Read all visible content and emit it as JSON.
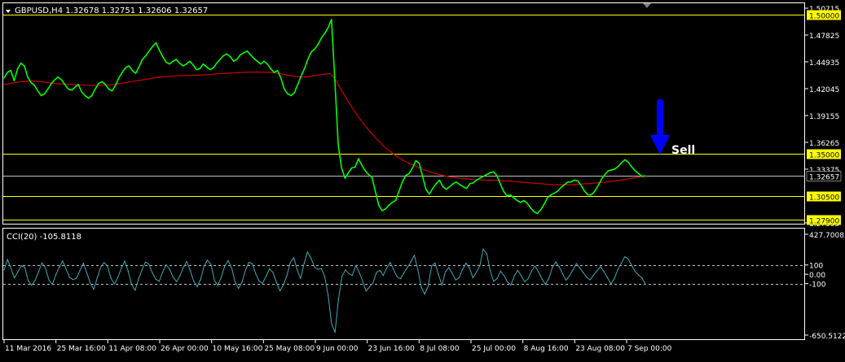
{
  "chart_data": [
    {
      "type": "candlestick-line",
      "title": "GBPUSD,H4  1.32678 1.32751 1.32606 1.32657",
      "symbol": "GBPUSD",
      "timeframe": "H4",
      "ohlc": {
        "open": 1.32678,
        "high": 1.32751,
        "low": 1.32606,
        "close": 1.32657
      },
      "x_tick_labels": [
        "11 Mar 2016",
        "25 Mar 16:00",
        "11 Apr 08:00",
        "26 Apr 00:00",
        "10 May 16:00",
        "25 May 08:00",
        "9 Jun 00:00",
        "23 Jun 16:00",
        "8 Jul 08:00",
        "25 Jul 00:00",
        "8 Aug 16:00",
        "23 Aug 08:00",
        "7 Sep 00:00"
      ],
      "y_tick_labels": [
        "1.50715",
        "1.47825",
        "1.44935",
        "1.42045",
        "1.39155",
        "1.36265",
        "1.33375",
        "1.27595"
      ],
      "ylim": [
        1.2759,
        1.5072
      ],
      "horizontal_levels": [
        {
          "value": 1.5,
          "label": "1.50000",
          "color": "#ffff00"
        },
        {
          "value": 1.35,
          "label": "1.35000",
          "color": "#ffff00"
        },
        {
          "value": 1.305,
          "label": "1.30500",
          "color": "#ffff00"
        },
        {
          "value": 1.279,
          "label": "1.27900",
          "color": "#ffff00"
        }
      ],
      "current_price": {
        "value": 1.32657,
        "label": "1.32657",
        "color": "#c0c0c0"
      },
      "series": [
        {
          "style": "price",
          "color": "#00ff00",
          "values": [
            1.432,
            1.438,
            1.44,
            1.429,
            1.442,
            1.448,
            1.445,
            1.433,
            1.427,
            1.424,
            1.418,
            1.413,
            1.415,
            1.42,
            1.426,
            1.43,
            1.433,
            1.43,
            1.425,
            1.42,
            1.419,
            1.422,
            1.425,
            1.417,
            1.413,
            1.41,
            1.413,
            1.42,
            1.426,
            1.428,
            1.425,
            1.42,
            1.418,
            1.424,
            1.432,
            1.438,
            1.443,
            1.445,
            1.44,
            1.437,
            1.444,
            1.452,
            1.456,
            1.461,
            1.466,
            1.47,
            1.462,
            1.455,
            1.449,
            1.447,
            1.45,
            1.452,
            1.448,
            1.445,
            1.447,
            1.45,
            1.446,
            1.441,
            1.442,
            1.447,
            1.444,
            1.441,
            1.443,
            1.448,
            1.452,
            1.456,
            1.458,
            1.455,
            1.45,
            1.452,
            1.457,
            1.459,
            1.461,
            1.457,
            1.453,
            1.45,
            1.447,
            1.45,
            1.447,
            1.442,
            1.438,
            1.44,
            1.432,
            1.42,
            1.415,
            1.413,
            1.416,
            1.425,
            1.434,
            1.442,
            1.452,
            1.46,
            1.463,
            1.468,
            1.475,
            1.48,
            1.486,
            1.495,
            1.43,
            1.36,
            1.335,
            1.324,
            1.33,
            1.335,
            1.336,
            1.345,
            1.338,
            1.332,
            1.328,
            1.325,
            1.31,
            1.295,
            1.289,
            1.291,
            1.295,
            1.298,
            1.3,
            1.31,
            1.32,
            1.327,
            1.329,
            1.335,
            1.343,
            1.34,
            1.326,
            1.312,
            1.307,
            1.313,
            1.318,
            1.322,
            1.315,
            1.312,
            1.315,
            1.318,
            1.32,
            1.317,
            1.315,
            1.313,
            1.318,
            1.319,
            1.322,
            1.324,
            1.326,
            1.328,
            1.33,
            1.331,
            1.327,
            1.318,
            1.31,
            1.305,
            1.306,
            1.303,
            1.3,
            1.298,
            1.3,
            1.297,
            1.292,
            1.288,
            1.286,
            1.29,
            1.296,
            1.303,
            1.306,
            1.308,
            1.31,
            1.314,
            1.317,
            1.32,
            1.32,
            1.322,
            1.321,
            1.316,
            1.31,
            1.306,
            1.306,
            1.31,
            1.316,
            1.323,
            1.328,
            1.332,
            1.333,
            1.334,
            1.337,
            1.341,
            1.344,
            1.341,
            1.336,
            1.332,
            1.329,
            1.326,
            1.3265
          ]
        },
        {
          "style": "moving-average",
          "color": "#cc0000",
          "values": [
            1.4248,
            1.4255,
            1.4262,
            1.4268,
            1.4275,
            1.428,
            1.4284,
            1.4287,
            1.4288,
            1.4286,
            1.4283,
            1.428,
            1.4275,
            1.427,
            1.4264,
            1.426,
            1.4257,
            1.4255,
            1.4254,
            1.4253,
            1.4251,
            1.425,
            1.4247,
            1.4245,
            1.4243,
            1.4242,
            1.424,
            1.424,
            1.424,
            1.4241,
            1.4242,
            1.4244,
            1.4247,
            1.4252,
            1.4258,
            1.4264,
            1.427,
            1.4276,
            1.4281,
            1.4286,
            1.4292,
            1.4298,
            1.4304,
            1.431,
            1.4316,
            1.4322,
            1.4327,
            1.4331,
            1.4334,
            1.4337,
            1.4339,
            1.4342,
            1.4344,
            1.4345,
            1.4347,
            1.4348,
            1.4349,
            1.4349,
            1.435,
            1.4352,
            1.4354,
            1.4356,
            1.4359,
            1.4362,
            1.4365,
            1.4368,
            1.437,
            1.4372,
            1.4374,
            1.4376,
            1.4378,
            1.438,
            1.4381,
            1.4382,
            1.4383,
            1.4383,
            1.4383,
            1.4382,
            1.4381,
            1.438,
            1.4377,
            1.4373,
            1.4368,
            1.4361,
            1.4354,
            1.4347,
            1.4341,
            1.4336,
            1.4332,
            1.433,
            1.4332,
            1.4336,
            1.4341,
            1.4346,
            1.4352,
            1.4358,
            1.4363,
            1.4368,
            1.4337,
            1.4279,
            1.4217,
            1.4156,
            1.4096,
            1.4038,
            1.3982,
            1.3929,
            1.3878,
            1.3829,
            1.3784,
            1.3742,
            1.3701,
            1.3661,
            1.3624,
            1.3589,
            1.3557,
            1.3527,
            1.35,
            1.3474,
            1.3452,
            1.3431,
            1.3412,
            1.3395,
            1.3379,
            1.3363,
            1.3348,
            1.3333,
            1.332,
            1.3307,
            1.3296,
            1.3286,
            1.3276,
            1.3268,
            1.326,
            1.3254,
            1.3249,
            1.3244,
            1.3239,
            1.3236,
            1.3232,
            1.3229,
            1.3226,
            1.3224,
            1.3222,
            1.322,
            1.3219,
            1.3218,
            1.3217,
            1.3216,
            1.3214,
            1.3212,
            1.321,
            1.3207,
            1.3204,
            1.3201,
            1.3198,
            1.3195,
            1.3192,
            1.3189,
            1.3186,
            1.3183,
            1.318,
            1.3177,
            1.3175,
            1.3173,
            1.3171,
            1.317,
            1.317,
            1.317,
            1.3171,
            1.3172,
            1.3174,
            1.3176,
            1.3178,
            1.318,
            1.3182,
            1.3185,
            1.3188,
            1.3191,
            1.3195,
            1.3199,
            1.3203,
            1.3207,
            1.3212,
            1.3217,
            1.3222,
            1.3228,
            1.3234,
            1.324,
            1.3246,
            1.3252,
            1.3258,
            1.3264
          ]
        }
      ],
      "annotation": {
        "text": "Sell",
        "arrow_direction": "down",
        "arrow_color": "#0000ff",
        "text_color": "#ffffff"
      }
    },
    {
      "type": "line",
      "title": "CCI(20) -105.8118",
      "indicator": "CCI",
      "period": 20,
      "current_value": -105.8118,
      "y_tick_labels": [
        "427.7008",
        "100",
        "0.00",
        "-100",
        "-650.5122"
      ],
      "ylim": [
        -650.5122,
        427.7008
      ],
      "reference_levels": [
        100,
        0,
        -100
      ],
      "series": [
        {
          "color": "#3fa9b6",
          "values": [
            47,
            159,
            61,
            -39,
            24,
            91,
            75,
            -69,
            -118,
            -65,
            25,
            123,
            67,
            -60,
            -108,
            -7,
            75,
            143,
            51,
            -34,
            -57,
            -42,
            41,
            120,
            16,
            -92,
            -161,
            -42,
            72,
            126,
            87,
            -43,
            -104,
            -33,
            64,
            142,
            33,
            -111,
            -171,
            -51,
            48,
            131,
            108,
            18,
            -53,
            -75,
            23,
            102,
            54,
            -28,
            -78,
            -18,
            75,
            136,
            38,
            -72,
            -133,
            -54,
            86,
            151,
            107,
            -63,
            -118,
            -28,
            87,
            148,
            69,
            -82,
            -150,
            -86,
            41,
            129,
            114,
            4,
            -76,
            -95,
            -19,
            58,
            21,
            -88,
            -177,
            -115,
            -16,
            124,
            178,
            50,
            -46,
            112,
            238,
            175,
            79,
            54,
            61,
            -22,
            -227,
            -531,
            -620,
            -265,
            -23,
            48,
            7,
            -12,
            94,
            22,
            -72,
            -180,
            -134,
            -93,
            21,
            42,
            -12,
            69,
            128,
            47,
            -28,
            -47,
            18,
            74,
            132,
            204,
            52,
            -137,
            -211,
            -129,
            89,
            121,
            -5,
            -117,
            28,
            72,
            9,
            -61,
            -34,
            56,
            118,
            67,
            -38,
            23,
            93,
            271,
            217,
            37,
            -77,
            -45,
            34,
            -14,
            -82,
            -114,
            -16,
            43,
            -16,
            -78,
            -47,
            36,
            89,
            27,
            -49,
            -108,
            -46,
            71,
            131,
            81,
            5,
            -64,
            -16,
            48,
            115,
            69,
            18,
            -34,
            -58,
            -8,
            38,
            82,
            28,
            -36,
            -101,
            -47,
            49,
            116,
            187,
            166,
            97,
            31,
            -6,
            -38,
            -105.8
          ]
        }
      ]
    }
  ]
}
